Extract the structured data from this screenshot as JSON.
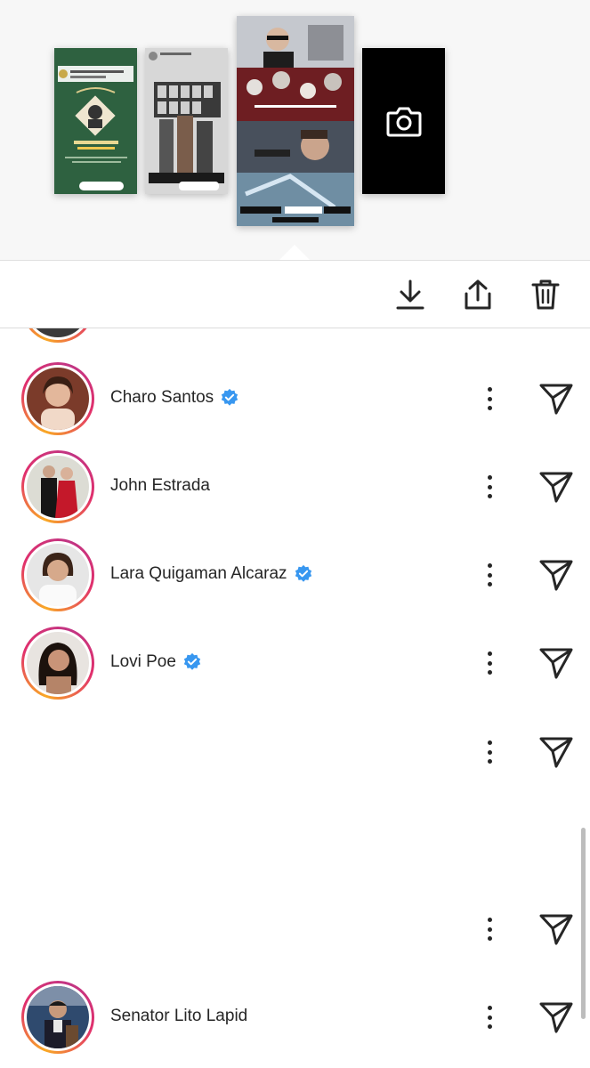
{
  "toolbar": {
    "download_icon": "download-icon",
    "share_icon": "share-icon",
    "delete_icon": "trash-icon"
  },
  "thumbnails": {
    "camera_icon": "camera-icon"
  },
  "viewers": [
    {
      "name": "Charo Santos",
      "verified": true
    },
    {
      "name": "John Estrada",
      "verified": false
    },
    {
      "name": "Lara Quigaman Alcaraz",
      "verified": true
    },
    {
      "name": "Lovi Poe",
      "verified": true
    },
    {
      "name": "",
      "verified": false
    },
    {
      "name": "",
      "verified": false
    },
    {
      "name": "",
      "verified": false
    },
    {
      "name": "Senator Lito Lapid",
      "verified": false
    }
  ],
  "colors": {
    "verified_blue": "#3897f0",
    "ring_start": "#f9a825",
    "ring_end": "#c13584"
  }
}
